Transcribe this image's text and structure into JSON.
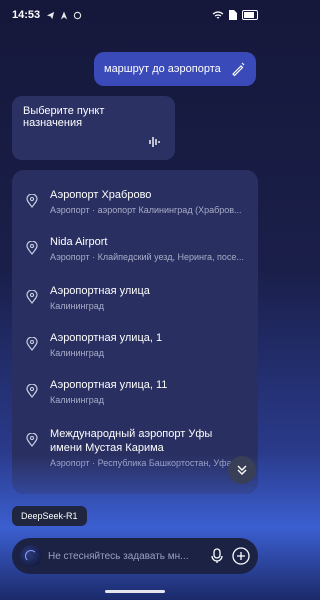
{
  "status": {
    "time": "14:53",
    "left_icons": [
      "telegram-icon",
      "navigation-icon",
      "sync-icon"
    ],
    "right_icons": [
      "wifi-icon",
      "sim-icon",
      "battery-icon"
    ]
  },
  "chat": {
    "user_message": "маршрут до аэропорта",
    "bot_message": "Выберите пункт назначения"
  },
  "results": [
    {
      "title": "Аэропорт Храброво",
      "subtitle": "Аэропорт · аэропорт Калининград (Храбров..."
    },
    {
      "title": "Nida Airport",
      "subtitle": "Аэропорт · Клайпедский уезд, Неринга, посе..."
    },
    {
      "title": "Аэропортная улица",
      "subtitle": "Калининград"
    },
    {
      "title": "Аэропортная улица, 1",
      "subtitle": "Калининград"
    },
    {
      "title": "Аэропортная улица, 11",
      "subtitle": "Калининград"
    },
    {
      "title": "Международный аэропорт Уфы имени Мустая Карима",
      "subtitle": "Аэропорт · Республика Башкортостан, Уфа..."
    }
  ],
  "model_badge": "DeepSeek-R1",
  "input": {
    "placeholder": "Не стесняйтесь задавать мн..."
  },
  "colors": {
    "accent_user_bubble": "#3a4ab8",
    "panel": "#292f60",
    "background_top": "#15183a"
  }
}
